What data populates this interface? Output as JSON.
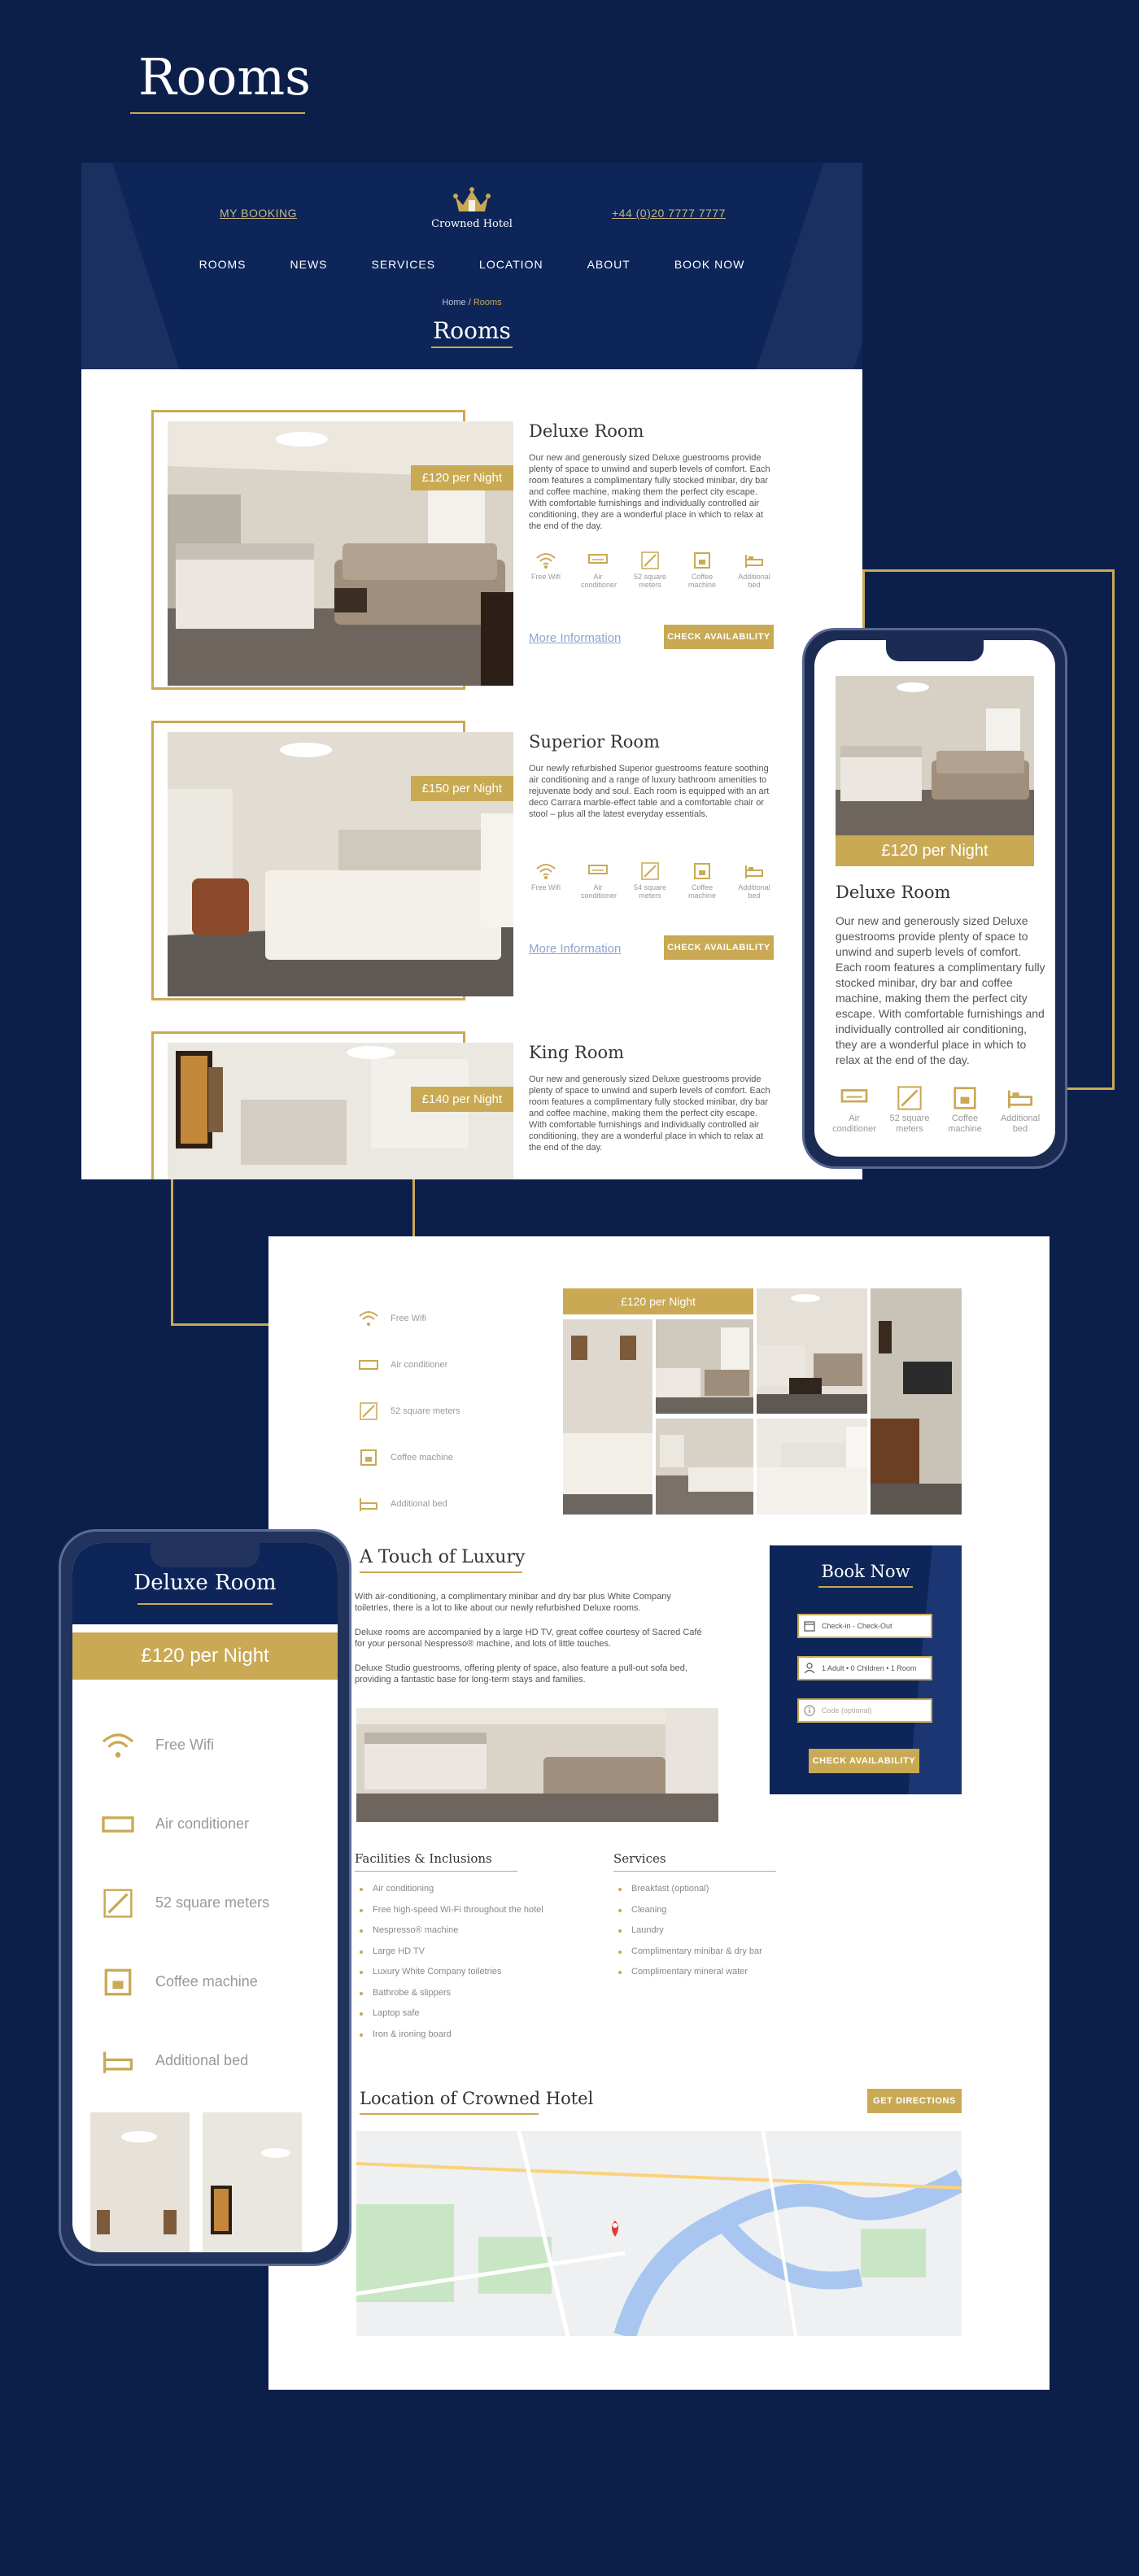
{
  "showcase": {
    "title": "Rooms"
  },
  "header": {
    "my_booking": "MY BOOKING",
    "phone": "+44 (0)20 7777 7777",
    "logo_text": "Crowned Hotel",
    "menu": [
      "ROOMS",
      "NEWS",
      "SERVICES",
      "LOCATION",
      "ABOUT",
      "BOOK NOW"
    ],
    "breadcrumb_home": "Home",
    "breadcrumb_sep": " / ",
    "breadcrumb_current": "Rooms",
    "page_title": "Rooms"
  },
  "amenity_labels": {
    "wifi": "Free Wifi",
    "ac": "Air conditioner",
    "size52": "52 square meters",
    "size54": "54 square meters",
    "coffee": "Coffee machine",
    "bed": "Additional bed"
  },
  "rooms": [
    {
      "name": "Deluxe Room",
      "price": "£120 per Night",
      "description": "Our new and generously sized Deluxe guestrooms provide plenty of space to unwind and superb levels of comfort. Each room features a complimentary fully stocked minibar, dry bar and coffee machine, making them the perfect city escape. With comfortable furnishings and individually controlled air conditioning, they are a wonderful place in which to relax at the end of the day.",
      "more_link": "More Information",
      "check_button": "CHECK AVAILABILITY"
    },
    {
      "name": "Superior Room",
      "price": "£150 per Night",
      "description": "Our newly refurbished Superior guestrooms feature soothing air conditioning and a range of luxury bathroom amenities to rejuvenate body and soul. Each room is equipped with an art deco Carrara marble-effect table and a comfortable chair or stool – plus all the latest everyday essentials.",
      "more_link": "More Information",
      "check_button": "CHECK AVAILABILITY"
    },
    {
      "name": "King Room",
      "price": "£140 per Night",
      "description": "Our new and generously sized Deluxe guestrooms provide plenty of space to unwind and superb levels of comfort. Each room features a complimentary fully stocked minibar, dry bar and coffee machine, making them the perfect city escape. With comfortable furnishings and individually controlled air conditioning, they are a wonderful place in which to relax at the end of the day."
    }
  ],
  "phone_card": {
    "price": "£120 per Night",
    "name": "Deluxe Room",
    "description": "Our new and generously sized Deluxe guestrooms provide plenty of space to unwind and superb levels of comfort. Each room features a complimentary fully stocked minibar, dry bar and coffee machine, making them the perfect city escape. With comfortable furnishings and individually controlled air conditioning, they are a wonderful place in which to relax at the end of the day.",
    "amenities": [
      "Air conditioner",
      "52 square meters",
      "Coffee machine",
      "Additional bed"
    ]
  },
  "detail": {
    "amenities": [
      "Free Wifi",
      "Air conditioner",
      "52 square meters",
      "Coffee machine",
      "Additional bed"
    ],
    "gallery_price": "£120 per Night",
    "touch_title": "A Touch of Luxury",
    "paragraphs": [
      "With air-conditioning, a complimentary minibar and dry bar plus White Company toiletries, there is a lot to like about our newly refurbished Deluxe rooms.",
      "Deluxe rooms are accompanied by a large HD TV, great coffee courtesy of Sacred Café for your personal Nespresso® machine, and lots of little touches.",
      "Deluxe Studio guestrooms, offering plenty of space, also feature a pull-out sofa bed, providing a fantastic base for long-term stays and families."
    ],
    "book": {
      "title": "Book Now",
      "dates": "Check-in - Check-Out",
      "guests": "1 Adult • 0 Children • 1 Room",
      "promo_placeholder": "Code (optional)",
      "button": "CHECK AVAILABILITY"
    },
    "facilities_title": "Facilities & Inclusions",
    "facilities": [
      "Air conditioning",
      "Free high-speed Wi-Fi throughout the hotel",
      "Nespresso® machine",
      "Large HD TV",
      "Luxury White Company toiletries",
      "Bathrobe & slippers",
      "Laptop safe",
      "Iron & ironing board"
    ],
    "services_title": "Services",
    "services": [
      "Breakfast (optional)",
      "Cleaning",
      "Laundry",
      "Complimentary minibar & dry bar",
      "Complimentary mineral water"
    ],
    "location_title": "Location of Crowned Hotel",
    "directions_button": "GET DIRECTIONS"
  },
  "phone2": {
    "title": "Deluxe Room",
    "price": "£120 per Night",
    "amenities": [
      "Free Wifi",
      "Air conditioner",
      "52 square meters",
      "Coffee machine",
      "Additional bed"
    ]
  },
  "colors": {
    "navy": "#0c1f4b",
    "gold": "#c9a953",
    "white": "#ffffff"
  },
  "icons": [
    "wifi-icon",
    "air-conditioner-icon",
    "square-meters-icon",
    "coffee-machine-icon",
    "bed-icon",
    "calendar-icon",
    "user-icon",
    "info-icon",
    "crown-logo-icon",
    "map-pin-icon"
  ]
}
